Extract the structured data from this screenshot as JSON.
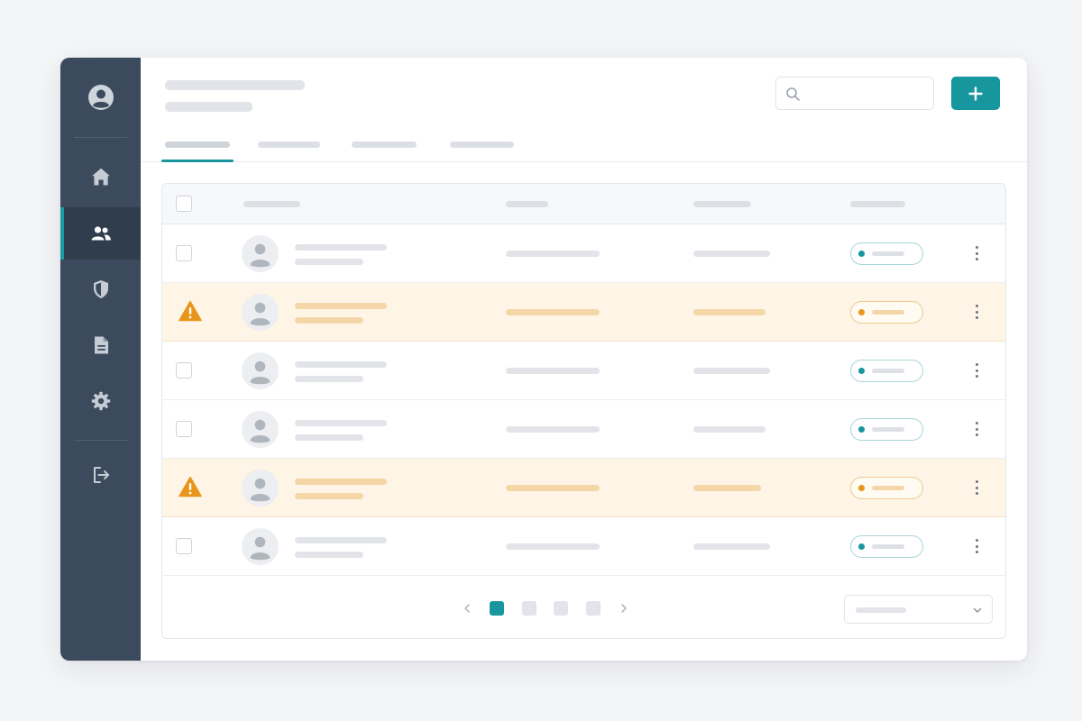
{
  "colors": {
    "sidebar": "#3b4a5c",
    "accent": "#17969e",
    "warning": "#e8951b",
    "warning_row": "#fff5e7"
  },
  "sidebar": {
    "items": [
      {
        "icon": "home-icon"
      },
      {
        "icon": "users-icon",
        "active": true
      },
      {
        "icon": "shield-icon"
      },
      {
        "icon": "document-icon"
      },
      {
        "icon": "gear-icon"
      },
      {
        "icon": "logout-icon"
      }
    ]
  },
  "header": {
    "search_icon": "search-icon",
    "add_button_icon": "plus-icon"
  },
  "tabs": {
    "count": 4,
    "active_index": 0
  },
  "table": {
    "rows": [
      {
        "status": "ok"
      },
      {
        "status": "warning"
      },
      {
        "status": "ok"
      },
      {
        "status": "ok"
      },
      {
        "status": "warning"
      },
      {
        "status": "ok"
      }
    ]
  },
  "pagination": {
    "pages": 4,
    "current_page": 1
  }
}
